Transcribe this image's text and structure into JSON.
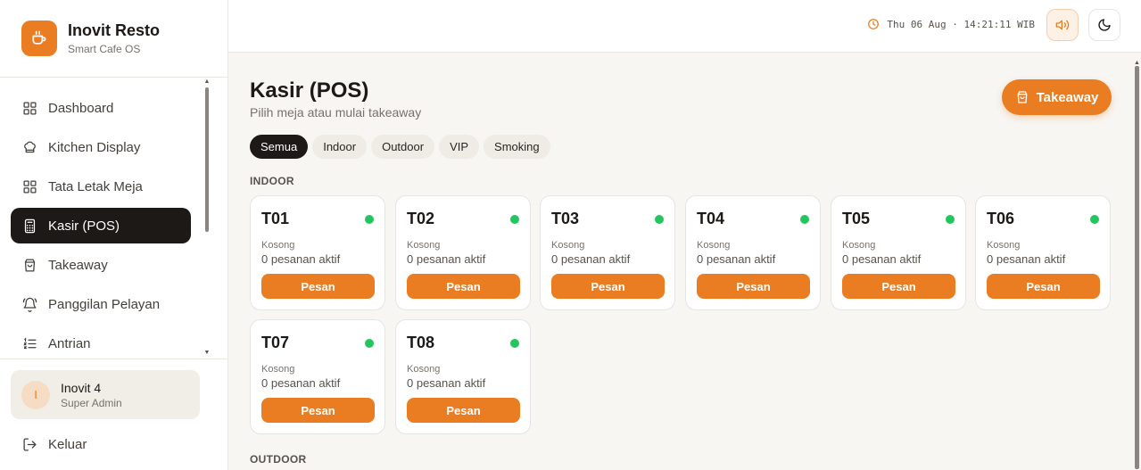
{
  "brand": {
    "name": "Inovit Resto",
    "subtitle": "Smart Cafe OS",
    "icon": "coffee-cup-icon"
  },
  "nav": [
    {
      "label": "Dashboard",
      "icon": "grid-icon",
      "active": false
    },
    {
      "label": "Kitchen Display",
      "icon": "chef-hat-icon",
      "active": false
    },
    {
      "label": "Tata Letak Meja",
      "icon": "layout-grid-icon",
      "active": false
    },
    {
      "label": "Kasir (POS)",
      "icon": "calculator-icon",
      "active": true
    },
    {
      "label": "Takeaway",
      "icon": "shopping-bag-icon",
      "active": false
    },
    {
      "label": "Panggilan Pelayan",
      "icon": "bell-icon",
      "active": false
    },
    {
      "label": "Antrian",
      "icon": "list-icon",
      "active": false
    }
  ],
  "user": {
    "initial": "I",
    "name": "Inovit 4",
    "role": "Super Admin"
  },
  "logout_label": "Keluar",
  "header": {
    "datetime": "Thu 06 Aug · 14:21:11 WIB"
  },
  "page": {
    "title": "Kasir (POS)",
    "subtitle": "Pilih meja atau mulai takeaway",
    "takeaway_label": "Takeaway"
  },
  "filters": [
    {
      "label": "Semua",
      "active": true
    },
    {
      "label": "Indoor",
      "active": false
    },
    {
      "label": "Outdoor",
      "active": false
    },
    {
      "label": "VIP",
      "active": false
    },
    {
      "label": "Smoking",
      "active": false
    }
  ],
  "sections": [
    {
      "label": "INDOOR",
      "tables": [
        {
          "name": "T01",
          "status": "Kosong",
          "orders": "0 pesanan aktif",
          "action": "Pesan"
        },
        {
          "name": "T02",
          "status": "Kosong",
          "orders": "0 pesanan aktif",
          "action": "Pesan"
        },
        {
          "name": "T03",
          "status": "Kosong",
          "orders": "0 pesanan aktif",
          "action": "Pesan"
        },
        {
          "name": "T04",
          "status": "Kosong",
          "orders": "0 pesanan aktif",
          "action": "Pesan"
        },
        {
          "name": "T05",
          "status": "Kosong",
          "orders": "0 pesanan aktif",
          "action": "Pesan"
        },
        {
          "name": "T06",
          "status": "Kosong",
          "orders": "0 pesanan aktif",
          "action": "Pesan"
        },
        {
          "name": "T07",
          "status": "Kosong",
          "orders": "0 pesanan aktif",
          "action": "Pesan"
        },
        {
          "name": "T08",
          "status": "Kosong",
          "orders": "0 pesanan aktif",
          "action": "Pesan"
        }
      ]
    },
    {
      "label": "OUTDOOR",
      "tables": []
    }
  ],
  "colors": {
    "accent": "#ea7d22",
    "dark": "#1c1917",
    "available": "#22c55e"
  }
}
